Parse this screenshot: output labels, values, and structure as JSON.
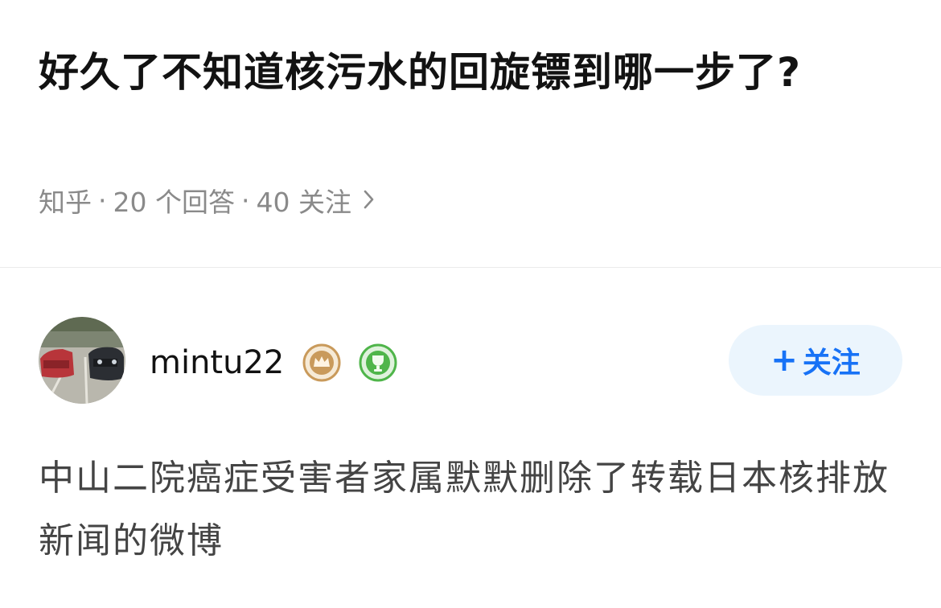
{
  "question": {
    "title": "好久了不知道核污水的回旋镖到哪一步了?",
    "source": "知乎",
    "answers_text": "20 个回答",
    "followers_text": "40 关注",
    "separator": "·"
  },
  "author": {
    "name": "mintu22",
    "badges": [
      "crown-badge-icon",
      "trophy-badge-icon"
    ]
  },
  "follow_button": {
    "plus": "+",
    "label": "关注"
  },
  "answer": {
    "excerpt": "中山二院癌症受害者家属默默删除了转载日本核排放新闻的微博"
  },
  "colors": {
    "title": "#121212",
    "meta": "#8a8a8a",
    "accent": "#1772f6",
    "follow_bg": "#ebf5fd",
    "badge_gold": "#c99a5b",
    "badge_green": "#4fb54a",
    "body_text": "#444444"
  }
}
